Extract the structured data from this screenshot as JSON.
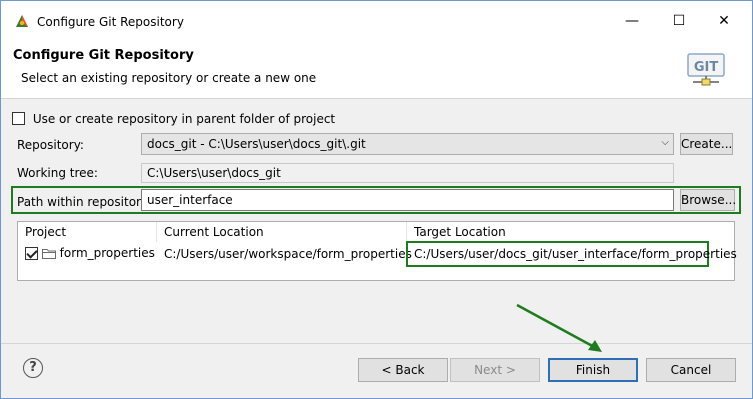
{
  "window": {
    "title": "Configure Git Repository",
    "controls": {
      "minimize": "—",
      "maximize": "☐",
      "close": "✕"
    }
  },
  "banner": {
    "title": "Configure Git Repository",
    "description": "Select an existing repository or create a new one",
    "logo_text": "GIT"
  },
  "options": {
    "parent_folder_label": "Use or create repository in parent folder of project",
    "parent_folder_checked": false
  },
  "form": {
    "repository_label": "Repository:",
    "repository_value": "docs_git - C:\\Users\\user\\docs_git\\.git",
    "create_button": "Create...",
    "working_tree_label": "Working tree:",
    "working_tree_value": "C:\\Users\\user\\docs_git",
    "path_label": "Path within repository:",
    "path_value": "user_interface",
    "browse_button": "Browse..."
  },
  "table": {
    "columns": [
      "Project",
      "Current Location",
      "Target Location"
    ],
    "rows": [
      {
        "checked": true,
        "project": "form_properties",
        "current_location": "C:/Users/user/workspace/form_properties",
        "target_location": "C:/Users/user/docs_git/user_interface/form_properties"
      }
    ]
  },
  "footer": {
    "help": "?",
    "back_button": "< Back",
    "next_button": "Next >",
    "finish_button": "Finish",
    "cancel_button": "Cancel"
  },
  "colors": {
    "highlight": "#1e7b1e",
    "default_button_border": "#2f6fb6",
    "dialog_bg": "#f0f0f0"
  }
}
